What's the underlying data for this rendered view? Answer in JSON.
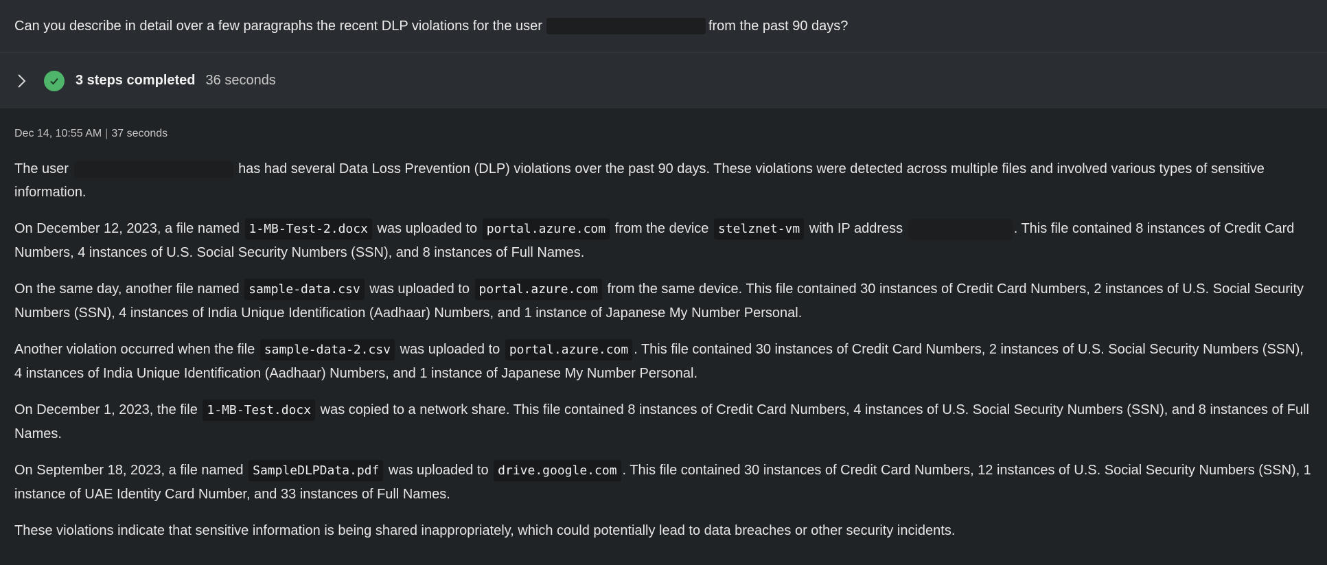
{
  "prompt": {
    "text_before": "Can you describe in detail over a few paragraphs the recent DLP violations for the user",
    "text_after": "from the past 90 days?"
  },
  "steps": {
    "label": "3 steps completed",
    "duration": "36 seconds"
  },
  "response": {
    "timestamp": "Dec 14, 10:55 AM",
    "separator": "|",
    "duration": "37 seconds",
    "p1": {
      "a": "The user",
      "b": "has had several Data Loss Prevention (DLP) violations over the past 90 days. These violations were detected across multiple files and involved various types of sensitive information."
    },
    "p2": {
      "a": "On December 12, 2023, a file named",
      "file": "1-MB-Test-2.docx",
      "b": "was uploaded to",
      "site": "portal.azure.com",
      "c": "from the device",
      "device": "stelznet-vm",
      "d": "with IP address",
      "e": ". This file contained 8 instances of Credit Card Numbers, 4 instances of U.S. Social Security Numbers (SSN), and 8 instances of Full Names."
    },
    "p3": {
      "a": "On the same day, another file named",
      "file": "sample-data.csv",
      "b": "was uploaded to",
      "site": "portal.azure.com",
      "c": "from the same device. This file contained 30 instances of Credit Card Numbers, 2 instances of U.S. Social Security Numbers (SSN), 4 instances of India Unique Identification (Aadhaar) Numbers, and 1 instance of Japanese My Number Personal."
    },
    "p4": {
      "a": "Another violation occurred when the file",
      "file": "sample-data-2.csv",
      "b": "was uploaded to",
      "site": "portal.azure.com",
      "c": ". This file contained 30 instances of Credit Card Numbers, 2 instances of U.S. Social Security Numbers (SSN), 4 instances of India Unique Identification (Aadhaar) Numbers, and 1 instance of Japanese My Number Personal."
    },
    "p5": {
      "a": "On December 1, 2023, the file",
      "file": "1-MB-Test.docx",
      "b": "was copied to a network share. This file contained 8 instances of Credit Card Numbers, 4 instances of U.S. Social Security Numbers (SSN), and 8 instances of Full Names."
    },
    "p6": {
      "a": "On September 18, 2023, a file named",
      "file": "SampleDLPData.pdf",
      "b": "was uploaded to",
      "site": "drive.google.com",
      "c": ". This file contained 30 instances of Credit Card Numbers, 12 instances of U.S. Social Security Numbers (SSN), 1 instance of UAE Identity Card Number, and 33 instances of Full Names."
    },
    "p7": "These violations indicate that sensitive information is being shared inappropriately, which could potentially lead to data breaches or other security incidents."
  },
  "colors": {
    "background": "#202326",
    "prompt_bg": "#292c30",
    "steps_bg": "#2a2d31",
    "success": "#4fb56a",
    "code_bg": "#17191b"
  },
  "icons": {
    "expand": "chevron-right-icon",
    "status": "check-circle-icon"
  }
}
